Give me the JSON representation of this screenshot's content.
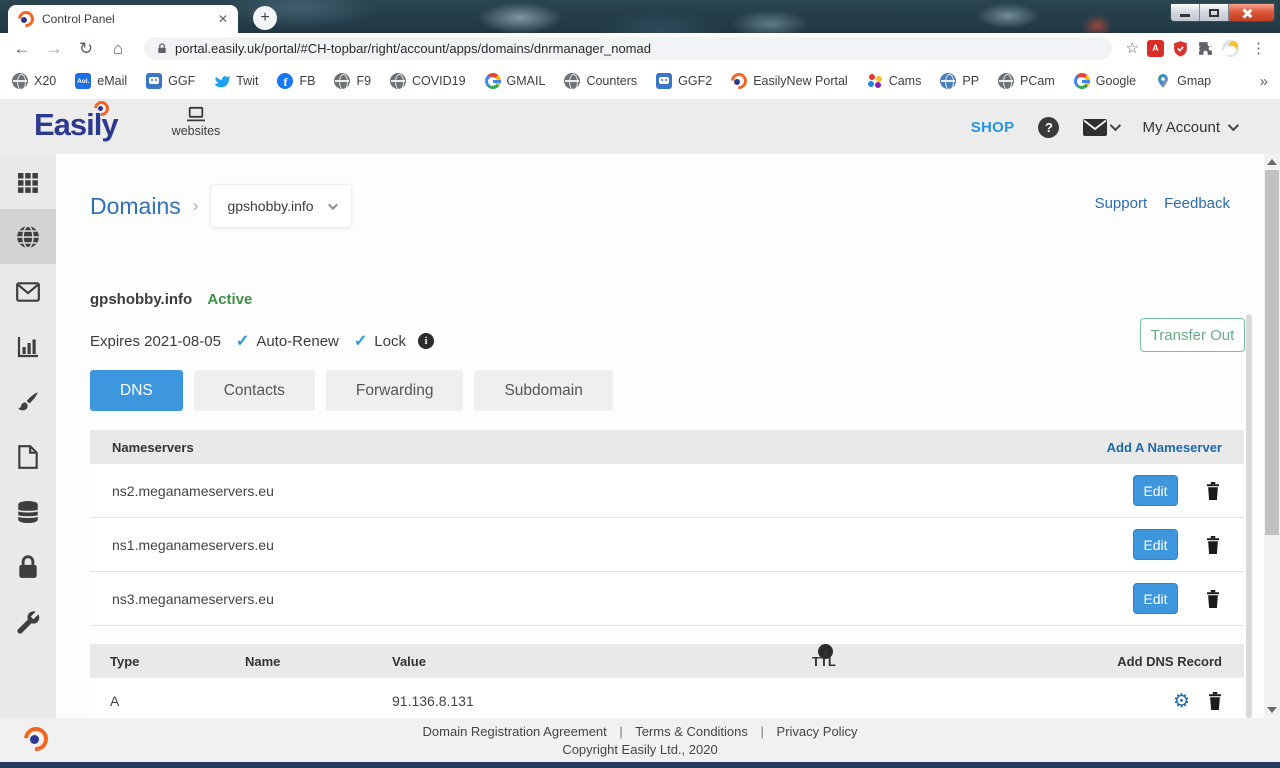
{
  "browser": {
    "tab_title": "Control Panel",
    "tab_close": "✕",
    "new_tab": "+",
    "nav": {
      "back": "←",
      "forward": "→",
      "reload": "↻",
      "home": "⌂"
    },
    "url": "portal.easily.uk/portal/#CH-topbar/right/account/apps/domains/dnrmanager_nomad",
    "star": "☆",
    "menu": "⋮",
    "adobe_glyph": "A",
    "overflow": "»",
    "favicon_glyphs": {
      "aol": "Aol.",
      "fb": "f"
    },
    "bookmarks": [
      {
        "label": "X20"
      },
      {
        "label": "eMail"
      },
      {
        "label": "GGF"
      },
      {
        "label": "Twit"
      },
      {
        "label": "FB"
      },
      {
        "label": "F9"
      },
      {
        "label": "COVID19"
      },
      {
        "label": "GMAIL"
      },
      {
        "label": "Counters"
      },
      {
        "label": "GGF2"
      },
      {
        "label": "EasilyNew Portal"
      },
      {
        "label": "Cams"
      },
      {
        "label": "PP"
      },
      {
        "label": "PCam"
      },
      {
        "label": "Google"
      },
      {
        "label": "Gmap"
      }
    ]
  },
  "header": {
    "logo_text": "Easily",
    "websites_label": "websites",
    "shop_label": "SHOP",
    "help_glyph": "?",
    "account_label": "My Account"
  },
  "page": {
    "breadcrumb_title": "Domains",
    "breadcrumb_sep": "›",
    "domain_selector": "gpshobby.info",
    "support_label": "Support",
    "feedback_label": "Feedback",
    "domain_name": "gpshobby.info",
    "status": "Active",
    "expires": "Expires 2021-08-05",
    "check_glyph": "✓",
    "auto_renew_label": "Auto-Renew",
    "lock_label": "Lock",
    "info_glyph": "i",
    "transfer_out_label": "Transfer Out",
    "tabs": [
      {
        "label": "DNS"
      },
      {
        "label": "Contacts"
      },
      {
        "label": "Forwarding"
      },
      {
        "label": "Subdomain"
      }
    ],
    "nameservers": {
      "title": "Nameservers",
      "add_link": "Add A Nameserver",
      "edit_label": "Edit",
      "items": [
        {
          "host": "ns2.meganameservers.eu"
        },
        {
          "host": "ns1.meganameservers.eu"
        },
        {
          "host": "ns3.meganameservers.eu"
        }
      ]
    },
    "dns_records": {
      "columns": {
        "type": "Type",
        "name": "Name",
        "value": "Value",
        "ttl": "TTL"
      },
      "add_link": "Add DNS Record",
      "gear_glyph": "⚙",
      "rows": [
        {
          "type": "A",
          "name": "",
          "value": "91.136.8.131"
        }
      ]
    },
    "footer": {
      "links": [
        {
          "label": "Domain Registration Agreement"
        },
        {
          "label": "Terms & Conditions"
        },
        {
          "label": "Privacy Policy"
        }
      ],
      "divider": "|",
      "copyright": "Copyright Easily Ltd., 2020"
    }
  }
}
